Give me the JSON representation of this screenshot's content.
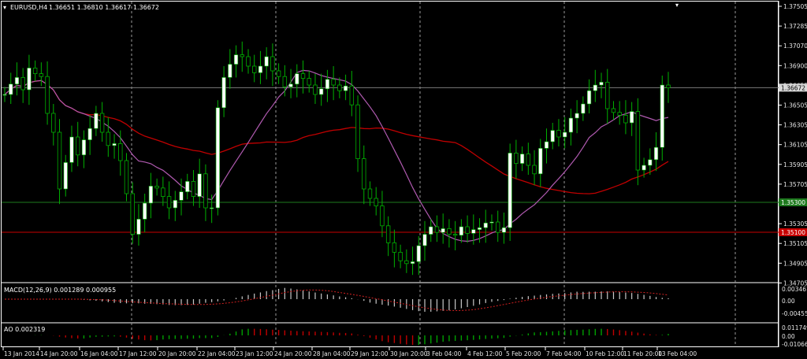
{
  "window": {
    "symbol_header": "EURUSD,H4",
    "ohlc_header": "1.36651 1.36810 1.36617 1.36672"
  },
  "macd": {
    "header": "MACD(12,26,9) 0.001289 0.000955",
    "ticks": [
      "0.003461",
      "0.00",
      "-0.00455"
    ]
  },
  "ao": {
    "header": "AO 0.002319",
    "ticks": [
      "0.011749",
      "0.00",
      "-0.01066"
    ]
  },
  "price_axis": {
    "ticks": [
      "1.37505",
      "1.37285",
      "1.37070",
      "1.36900",
      "1.36655",
      "1.36505",
      "1.36305",
      "1.36105",
      "1.35905",
      "1.35705",
      "1.35505",
      "1.35305",
      "1.35105",
      "1.34905",
      "1.34705"
    ],
    "current_price": "1.36672",
    "green_line_label": "1.35300",
    "red_line_label": "1.35100"
  },
  "time_axis": [
    "13 Jan 2014",
    "14 Jan 20:00",
    "16 Jan 04:00",
    "17 Jan 12:00",
    "20 Jan 20:00",
    "22 Jan 04:00",
    "23 Jan 12:00",
    "24 Jan 20:00",
    "28 Jan 04:00",
    "29 Jan 12:00",
    "30 Jan 20:00",
    "3 Feb 04:00",
    "4 Feb 12:00",
    "5 Feb 20:00",
    "7 Feb 04:00",
    "10 Feb 12:00",
    "11 Feb 20:00",
    "13 Feb 04:00"
  ],
  "colors": {
    "background": "#000000",
    "bull_candle": "#ffffff",
    "wick": "#00b000",
    "ma_red": "#c00000",
    "ma_purple": "#b05ab0",
    "level_green": "#1e7a1e",
    "level_red": "#c80000",
    "grid": "#9a9a9a"
  },
  "chart_data": {
    "type": "candlestick",
    "title": "EURUSD,H4",
    "ylim": [
      1.3465,
      1.3755
    ],
    "closes": [
      1.366,
      1.3671,
      1.3678,
      1.3665,
      1.3688,
      1.3682,
      1.3679,
      1.364,
      1.362,
      1.356,
      1.3588,
      1.3615,
      1.3596,
      1.3612,
      1.3624,
      1.364,
      1.362,
      1.3606,
      1.3608,
      1.359,
      1.3555,
      1.3512,
      1.3528,
      1.3545,
      1.3563,
      1.3561,
      1.3552,
      1.354,
      1.3548,
      1.3557,
      1.3568,
      1.3552,
      1.3576,
      1.354,
      1.354,
      1.3646,
      1.3678,
      1.3692,
      1.3702,
      1.37,
      1.369,
      1.3683,
      1.369,
      1.37,
      1.3685,
      1.3679,
      1.3668,
      1.3671,
      1.3682,
      1.3677,
      1.367,
      1.366,
      1.3666,
      1.3676,
      1.367,
      1.3664,
      1.3669,
      1.3649,
      1.3592,
      1.356,
      1.355,
      1.3542,
      1.3521,
      1.3503,
      1.3493,
      1.3484,
      1.3481,
      1.3483,
      1.35,
      1.3512,
      1.352,
      1.3514,
      1.3518,
      1.3512,
      1.3511,
      1.352,
      1.3513,
      1.3517,
      1.3519,
      1.3524,
      1.3525,
      1.3514,
      1.3519,
      1.3598,
      1.3587,
      1.3597,
      1.3585,
      1.3576,
      1.3603,
      1.361,
      1.3622,
      1.3615,
      1.362,
      1.3635,
      1.364,
      1.365,
      1.3664,
      1.367,
      1.3673,
      1.3645,
      1.3641,
      1.3638,
      1.363,
      1.3642,
      1.358,
      1.3585,
      1.3591,
      1.3604,
      1.367,
      1.3667
    ]
  }
}
